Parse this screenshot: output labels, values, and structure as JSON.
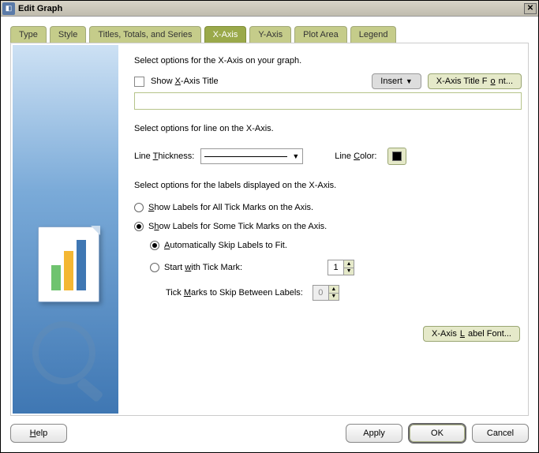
{
  "window": {
    "title": "Edit Graph"
  },
  "tabs": {
    "type": "Type",
    "style": "Style",
    "titles": "Titles, Totals, and Series",
    "xaxis": "X-Axis",
    "yaxis": "Y-Axis",
    "plot": "Plot Area",
    "legend": "Legend"
  },
  "xaxis": {
    "intro": "Select options for the X-Axis on your graph.",
    "show_title_label": "Show X-Axis Title",
    "insert_btn": "Insert",
    "title_font_btn": "X-Axis Title Font...",
    "title_value": "",
    "line_intro": "Select options for line on the X-Axis.",
    "thickness_label": "Line Thickness:",
    "color_label": "Line Color:",
    "labels_intro": "Select options for the labels displayed on the X-Axis.",
    "labels_all": "Show Labels for All Tick Marks on the Axis.",
    "labels_some": "Show Labels for Some Tick Marks on the Axis.",
    "auto_skip": "Automatically Skip Labels to Fit.",
    "start_tick": "Start with Tick Mark:",
    "start_tick_value": "1",
    "skip_label": "Tick Marks to Skip Between Labels:",
    "skip_value": "0",
    "label_font_btn": "X-Axis Label Font..."
  },
  "footer": {
    "help": "Help",
    "apply": "Apply",
    "ok": "OK",
    "cancel": "Cancel"
  }
}
